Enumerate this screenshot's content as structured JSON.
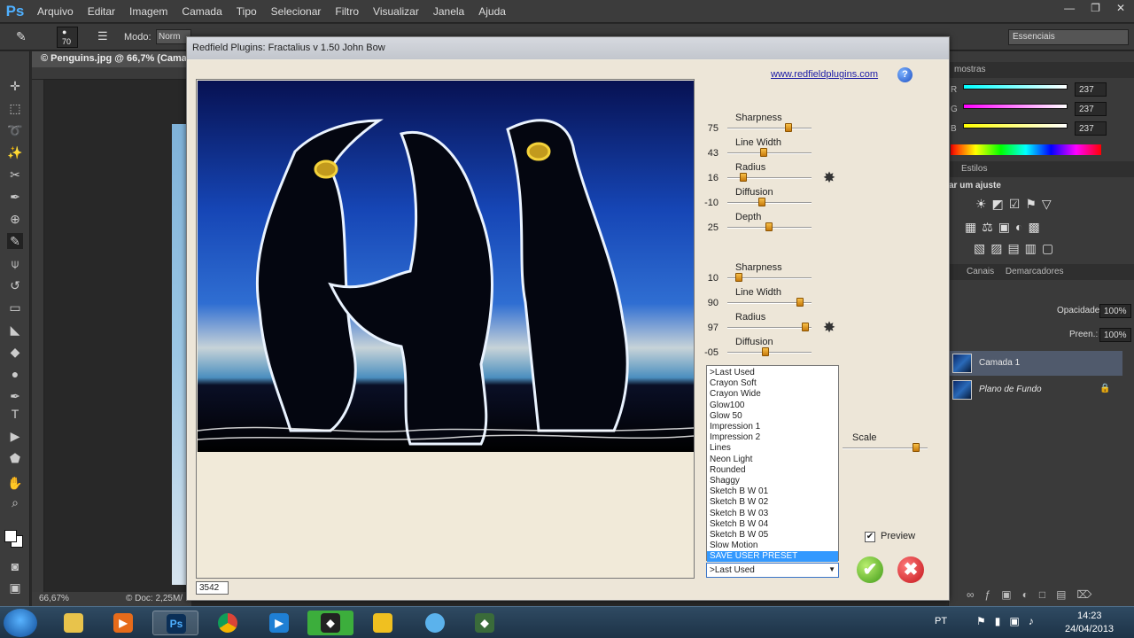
{
  "menubar": {
    "logo": "Ps",
    "items": [
      "Arquivo",
      "Editar",
      "Imagem",
      "Camada",
      "Tipo",
      "Selecionar",
      "Filtro",
      "Visualizar",
      "Janela",
      "Ajuda"
    ]
  },
  "options_bar": {
    "brush_size": "70",
    "modo_label": "Modo:",
    "modo_value": "Norm",
    "workspace": "Essenciais"
  },
  "document": {
    "tab_title": "© Penguins.jpg @ 66,7% (Camad",
    "zoom": "66,67%",
    "doc_info": "© Doc: 2,25M/"
  },
  "right_panels": {
    "amostras_tab": "mostras",
    "color_values": [
      "237",
      "237",
      "237"
    ],
    "channels": [
      "R",
      "G",
      "B"
    ],
    "estilos_tab": "Estilos",
    "ajuste_label": "ar um ajuste",
    "canais_tab": "Canais",
    "demarcadores_tab": "Demarcadores",
    "opacidade_label": "Opacidade:",
    "opacidade_value": "100%",
    "preen_label": "Preen.:",
    "preen_value": "100%",
    "layers": [
      {
        "name": "Camada 1",
        "selected": true
      },
      {
        "name": "Plano de Fundo",
        "selected": false
      }
    ]
  },
  "dialog": {
    "title": "Redfield Plugins: Fractalius v 1.50   John Bow",
    "website": "www.redfieldplugins.com",
    "help": "?",
    "counter": "3542",
    "group1": [
      {
        "label": "Sharpness",
        "value": "75",
        "level": 0.75
      },
      {
        "label": "Line Width",
        "value": "43",
        "level": 0.43
      },
      {
        "label": "Radius",
        "value": "16",
        "level": 0.16
      },
      {
        "label": "Diffusion",
        "value": "-10",
        "level": 0.4
      },
      {
        "label": "Depth",
        "value": "25",
        "level": 0.49
      }
    ],
    "group2": [
      {
        "label": "Sharpness",
        "value": "10",
        "level": 0.1
      },
      {
        "label": "Line Width",
        "value": "90",
        "level": 0.9
      },
      {
        "label": "Radius",
        "value": "97",
        "level": 0.97
      },
      {
        "label": "Diffusion",
        "value": "-05",
        "level": 0.45
      }
    ],
    "scale_label": "Scale",
    "scale_level": 0.9,
    "presets": [
      ">Last Used",
      "Crayon Soft",
      "Crayon Wide",
      "Glow100",
      "Glow 50",
      "Impression 1",
      "Impression 2",
      "Lines",
      "Neon Light",
      "Rounded",
      "Shaggy",
      "Sketch B W 01",
      "Sketch B W 02",
      "Sketch B W 03",
      "Sketch B W 04",
      "Sketch B W 05",
      "Slow Motion",
      "SAVE USER PRESET"
    ],
    "highlighted_preset": "SAVE USER PRESET",
    "selected_preset": ">Last Used",
    "preview_label": "Preview",
    "preview_checked": true,
    "ok_symbol": "✔",
    "cancel_symbol": "✖"
  },
  "taskbar": {
    "lang": "PT",
    "time": "14:23",
    "date": "24/04/2013",
    "ps_glyph": "Ps"
  }
}
